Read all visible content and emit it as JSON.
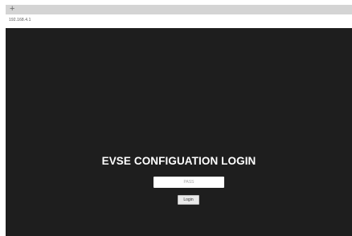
{
  "browser": {
    "new_tab_symbol": "+",
    "url": "192.168.4.1"
  },
  "page": {
    "title": "EVSE CONFIGUATION LOGIN",
    "password_placeholder": "PASS",
    "password_value": "",
    "login_label": "Login"
  },
  "colors": {
    "page_background": "#1e1e1e",
    "title_text": "#ffffff",
    "tab_bar": "#d4d4d4"
  }
}
